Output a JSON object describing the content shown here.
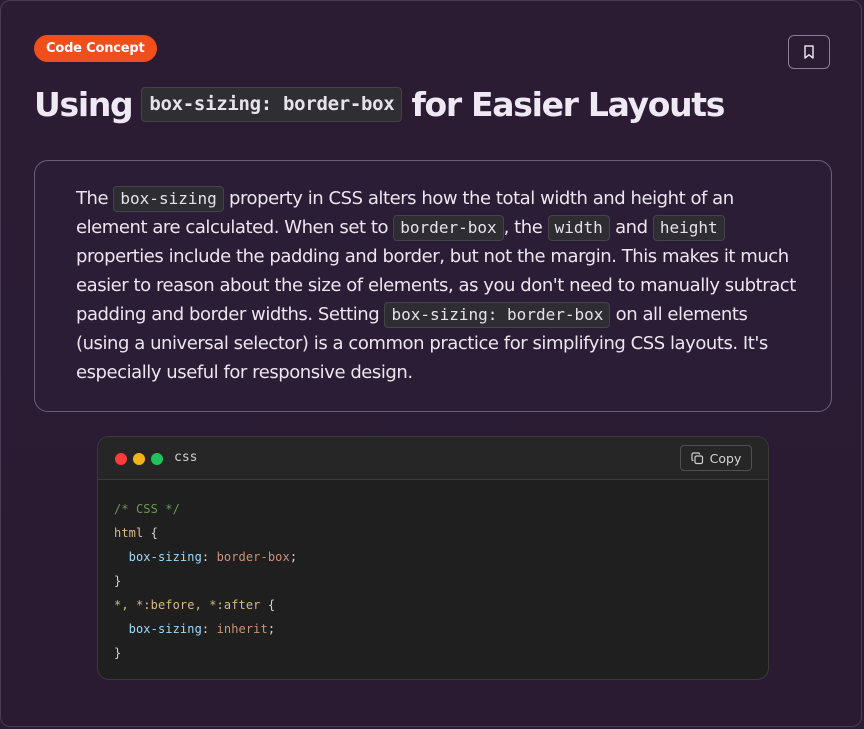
{
  "badge": {
    "label": "Code Concept",
    "color": "#f04e1a"
  },
  "bookmark": {
    "icon": "bookmark-icon"
  },
  "title": {
    "before": "Using",
    "code": "box-sizing: border-box",
    "after": "for Easier Layouts"
  },
  "description": {
    "t1": "The ",
    "c1": "box-sizing",
    "t2": " property in CSS alters how the total width and height of an element are calculated. When set to ",
    "c2": "border-box",
    "t3": ", the ",
    "c3": "width",
    "t4": " and ",
    "c4": "height",
    "t5": " properties include the padding and border, but not the margin. This makes it much easier to reason about the size of elements, as you don't need to manually subtract padding and border widths. Setting ",
    "c5": "box-sizing: border-box",
    "t6": " on all elements (using a universal selector) is a common practice for simplifying CSS layouts. It's especially useful for responsive design."
  },
  "code_block": {
    "language": "css",
    "copy_label": "Copy",
    "copy_icon": "copy-icon",
    "window_dots": [
      "#ff3b3b",
      "#f5b31b",
      "#21c45a"
    ],
    "lines": {
      "l1_comment": "/* CSS */",
      "l2_selector": "html",
      "l2_brace": " {",
      "l3_prop": "box-sizing",
      "l3_colon": ": ",
      "l3_value": "border-box",
      "l3_semi": ";",
      "l4_brace": "}",
      "l5_selector": "*, *:before, *:after",
      "l5_brace": " {",
      "l6_prop": "box-sizing",
      "l6_colon": ": ",
      "l6_value": "inherit",
      "l6_semi": ";",
      "l7_brace": "}"
    }
  }
}
